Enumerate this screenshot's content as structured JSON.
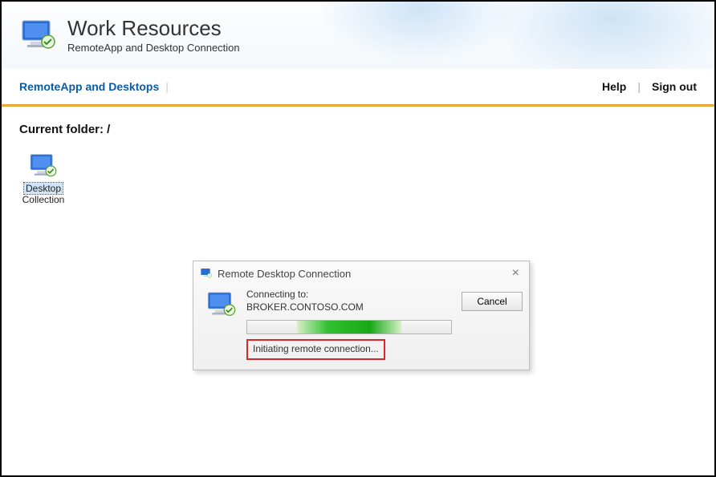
{
  "header": {
    "app_title": "Work Resources",
    "app_subtitle": "RemoteApp and Desktop Connection"
  },
  "nav": {
    "left_label": "RemoteApp and Desktops",
    "help_label": "Help",
    "signout_label": "Sign out"
  },
  "main": {
    "current_folder_label": "Current folder: /",
    "items": [
      {
        "line1": "Desktop",
        "line2": "Collection"
      }
    ]
  },
  "dialog": {
    "title": "Remote Desktop Connection",
    "connecting_label": "Connecting to:",
    "host": "BROKER.CONTOSO.COM",
    "cancel_label": "Cancel",
    "status": "Initiating remote connection..."
  }
}
